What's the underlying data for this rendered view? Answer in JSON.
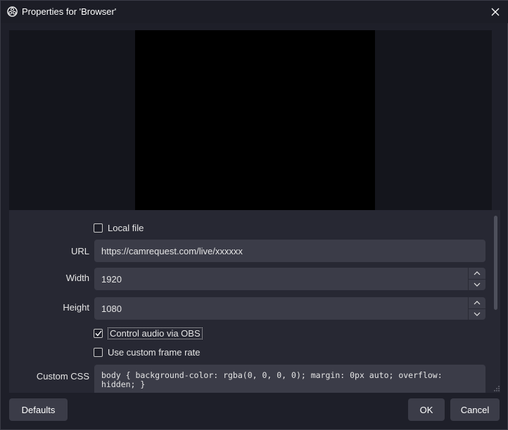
{
  "window": {
    "title": "Properties for 'Browser'",
    "app_icon": "obs-logo-icon",
    "close_icon": "close-icon"
  },
  "properties": {
    "local_file": {
      "label": "Local file",
      "checked": false
    },
    "url": {
      "label": "URL",
      "value": "https://camrequest.com/live/xxxxxx"
    },
    "width": {
      "label": "Width",
      "value": "1920"
    },
    "height": {
      "label": "Height",
      "value": "1080"
    },
    "control_audio": {
      "label": "Control audio via OBS",
      "checked": true
    },
    "custom_frame_rate": {
      "label": "Use custom frame rate",
      "checked": false
    },
    "custom_css": {
      "label": "Custom CSS",
      "value": "body { background-color: rgba(0, 0, 0, 0); margin: 0px auto; overflow:\nhidden; }"
    }
  },
  "buttons": {
    "defaults": "Defaults",
    "ok": "OK",
    "cancel": "Cancel"
  },
  "colors": {
    "window_bg": "#1e1f29",
    "panel_bg": "#272833",
    "field_bg": "#3b3c48",
    "preview_bg": "#000000"
  }
}
